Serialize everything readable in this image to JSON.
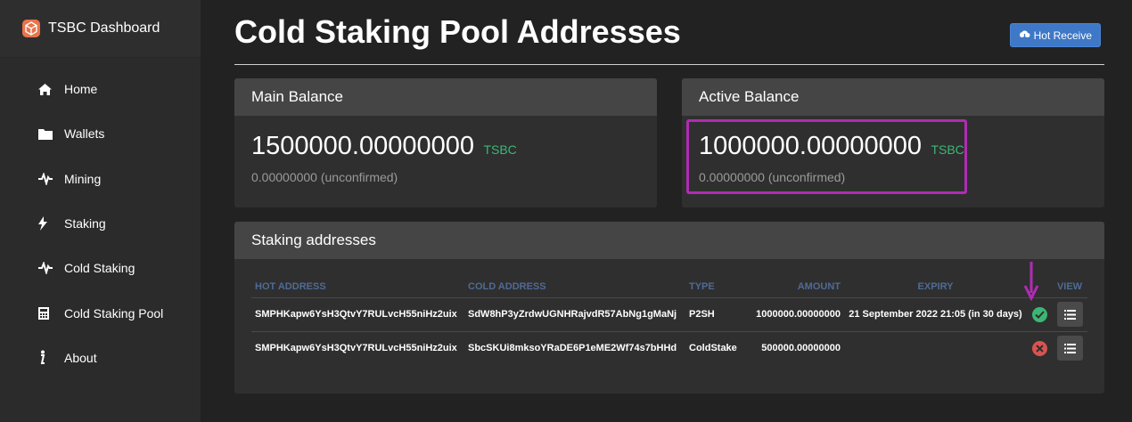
{
  "app": {
    "brand": "TSBC Dashboard"
  },
  "sidebar": {
    "items": [
      {
        "label": "Home",
        "icon": "home-icon"
      },
      {
        "label": "Wallets",
        "icon": "folder-icon"
      },
      {
        "label": "Mining",
        "icon": "activity-icon"
      },
      {
        "label": "Staking",
        "icon": "lightning-icon"
      },
      {
        "label": "Cold Staking",
        "icon": "activity-icon"
      },
      {
        "label": "Cold Staking Pool",
        "icon": "calculator-icon"
      },
      {
        "label": "About",
        "icon": "info-icon"
      }
    ]
  },
  "page": {
    "title": "Cold Staking Pool Addresses",
    "hot_receive_label": "Hot Receive"
  },
  "main_balance": {
    "heading": "Main Balance",
    "value": "1500000.00000000",
    "unit": "TSBC",
    "unconfirmed": "0.00000000 (unconfirmed)"
  },
  "active_balance": {
    "heading": "Active Balance",
    "value": "1000000.00000000",
    "unit": "TSBC",
    "unconfirmed": "0.00000000 (unconfirmed)"
  },
  "staking": {
    "heading": "Staking addresses",
    "columns": [
      "HOT ADDRESS",
      "COLD ADDRESS",
      "TYPE",
      "AMOUNT",
      "EXPIRY",
      "",
      "VIEW"
    ],
    "rows": [
      {
        "hot": "SMPHKapw6YsH3QtvY7RULvcH55niHz2uix",
        "cold": "SdW8hP3yZrdwUGNHRajvdR57AbNg1gMaNj",
        "type": "P2SH",
        "amount": "1000000.00000000",
        "expiry": "21 September 2022 21:05 (in 30 days)",
        "status": "active"
      },
      {
        "hot": "SMPHKapw6YsH3QtvY7RULvcH55niHz2uix",
        "cold": "SbcSKUi8mksoYRaDE6P1eME2Wf74s7bHHd",
        "type": "ColdStake",
        "amount": "500000.00000000",
        "expiry": "",
        "status": "inactive"
      }
    ]
  },
  "colors": {
    "accent": "#3f78c7",
    "unit_green": "#3bb774",
    "error_red": "#d9534f",
    "highlight": "#b02cb4",
    "header_text": "#4f6b96"
  }
}
